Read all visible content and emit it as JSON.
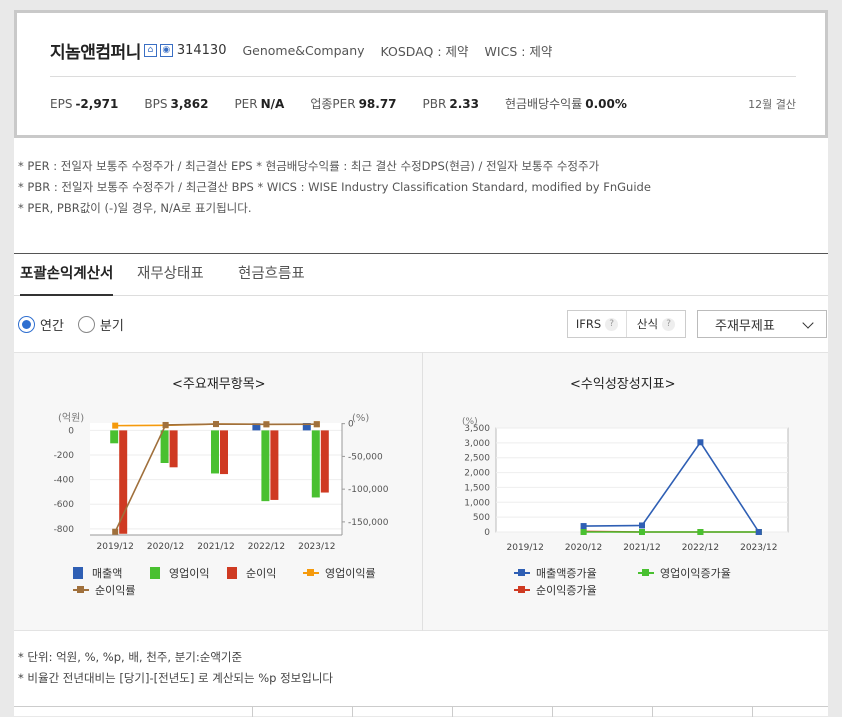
{
  "header": {
    "company_name": "지놈앤컴퍼니",
    "ticker": "314130",
    "english_name": "Genome&Company",
    "market": "KOSDAQ : 제약",
    "wics": "WICS : 제약",
    "settlement": "12월 결산",
    "icons": [
      "home-icon",
      "report-icon"
    ]
  },
  "metrics": [
    {
      "label": "EPS",
      "value": "-2,971"
    },
    {
      "label": "BPS",
      "value": "3,862"
    },
    {
      "label": "PER",
      "value": "N/A"
    },
    {
      "label": "업종PER",
      "value": "98.77"
    },
    {
      "label": "PBR",
      "value": "2.33"
    },
    {
      "label": "현금배당수익률",
      "value": "0.00%"
    }
  ],
  "notes": [
    "* PER : 전일자 보통주 수정주가 / 최근결산 EPS * 현금배당수익률 : 최근 결산 수정DPS(현금) / 전일자 보통주 수정주가",
    "* PBR : 전일자 보통주 수정주가 / 최근결산 BPS * WICS : WISE Industry Classification Standard, modified by FnGuide",
    "* PER, PBR값이 (-)일 경우, N/A로 표기됩니다."
  ],
  "tabs": [
    {
      "label": "포괄손익계산서",
      "active": true
    },
    {
      "label": "재무상태표",
      "active": false
    },
    {
      "label": "현금흐름표",
      "active": false
    }
  ],
  "period": {
    "annual": "연간",
    "quarter": "분기",
    "selected": "annual"
  },
  "options": {
    "ifrs": "IFRS",
    "calc": "산식",
    "help": "?"
  },
  "statement_select": {
    "value": "주재무제표"
  },
  "footnotes": [
    "* 단위: 억원, %, %p, 배, 천주, 분기:순액기준",
    "* 비율간 전년대비는 [당기]-[전년도] 로 계산되는 %p 정보입니다"
  ],
  "colors": {
    "revenue": "#2f5fb4",
    "op_income": "#49c030",
    "net_income": "#cf3a22",
    "op_rate": "#f59a0c",
    "net_rate": "#a0703c",
    "rev_growth": "#2f5fb4",
    "op_growth": "#49c030",
    "net_growth": "#cf3a22"
  },
  "chart_data": [
    {
      "type": "bar",
      "title": "<주요재무항목>",
      "categories": [
        "2019/12",
        "2020/12",
        "2021/12",
        "2022/12",
        "2023/12"
      ],
      "left_axis": {
        "label": "(억원)",
        "ticks": [
          0,
          -200,
          -400,
          -600,
          -800
        ],
        "ylim": [
          -850,
          60
        ]
      },
      "right_axis": {
        "label": "(%)",
        "ticks": [
          0,
          -50000,
          -100000,
          -150000
        ],
        "ylim": [
          -170000,
          1000
        ]
      },
      "series": [
        {
          "name": "매출액",
          "axis": "left",
          "values": [
            0,
            0,
            0,
            58,
            60
          ]
        },
        {
          "name": "영업이익",
          "axis": "left",
          "values": [
            -105,
            -265,
            -350,
            -575,
            -545
          ]
        },
        {
          "name": "순이익",
          "axis": "left",
          "values": [
            -840,
            -300,
            -355,
            -565,
            -505
          ]
        },
        {
          "name": "영업이익률",
          "axis": "right",
          "values": [
            -3000,
            -2500,
            -600,
            -990,
            -909
          ]
        },
        {
          "name": "순이익률",
          "axis": "right",
          "values": [
            -165000,
            -2000,
            -600,
            -970,
            -845
          ]
        }
      ],
      "legend": "bottom"
    },
    {
      "type": "line",
      "title": "<수익성장성지표>",
      "categories": [
        "2019/12",
        "2020/12",
        "2021/12",
        "2022/12",
        "2023/12"
      ],
      "y_axis": {
        "label": "(%)",
        "ticks": [
          "3,500",
          "3,000",
          "2,500",
          "2,000",
          "1,500",
          "1,000",
          "500",
          "0"
        ],
        "ylim": [
          0,
          3500
        ]
      },
      "series": [
        {
          "name": "매출액증가율",
          "values": [
            null,
            200,
            220,
            3020,
            0
          ]
        },
        {
          "name": "영업이익증가율",
          "values": [
            null,
            0,
            0,
            0,
            0
          ]
        },
        {
          "name": "순이익증가율",
          "values": [
            null,
            20,
            0,
            0,
            0
          ]
        }
      ],
      "legend": "bottom"
    }
  ]
}
